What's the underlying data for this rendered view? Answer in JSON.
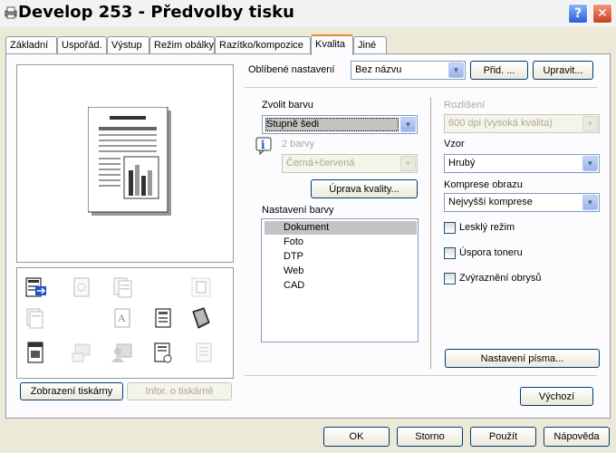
{
  "window": {
    "title": "Develop 253 - Předvolby tisku",
    "help_glyph": "?",
    "close_glyph": "✕"
  },
  "tabs": [
    "Základní",
    "Uspořád.",
    "Výstup",
    "Režim obálky",
    "Razítko/kompozice",
    "Kvalita",
    "Jiné"
  ],
  "active_tab": "Kvalita",
  "favorites": {
    "label": "Oblíbené nastavení",
    "value": "Bez názvu",
    "add_button": "Přid. ...",
    "edit_button": "Upravit..."
  },
  "color": {
    "select_label": "Zvolit barvu",
    "select_value": "Stupně šedi",
    "two_colors_label": "2 barvy",
    "two_colors_value": "Černá+červená",
    "quality_button": "Úprava kvality...",
    "settings_label": "Nastavení barvy",
    "settings_items": [
      "Dokument",
      "Foto",
      "DTP",
      "Web",
      "CAD"
    ],
    "selected_item": "Dokument"
  },
  "right": {
    "resolution_label": "Rozlišení",
    "resolution_value": "600 dpi (vysoká kvalita)",
    "pattern_label": "Vzor",
    "pattern_value": "Hrubý",
    "compression_label": "Komprese obrazu",
    "compression_value": "Nejvyšší komprese",
    "glossy_label": "Lesklý režim",
    "toner_label": "Úspora toneru",
    "edge_label": "Zvýraznění obrysů",
    "font_button": "Nastavení písma..."
  },
  "left": {
    "printer_view_button": "Zobrazení tiskárny",
    "printer_info_button": "Infor. o tiskárně"
  },
  "default_button": "Výchozí",
  "footer": {
    "ok": "OK",
    "cancel": "Storno",
    "apply": "Použít",
    "help": "Nápověda"
  },
  "icons": [
    "printer-icon",
    "info-icon",
    "chevron-down-icon",
    "page-preview-icon",
    "stapler-icon",
    "booklet-icon",
    "duplex-icon",
    "fold-icon",
    "copies-icon",
    "font-icon",
    "fax-icon",
    "cover-icon",
    "watermark-icon",
    "user-icon",
    "settings-icon",
    "form-icon"
  ]
}
